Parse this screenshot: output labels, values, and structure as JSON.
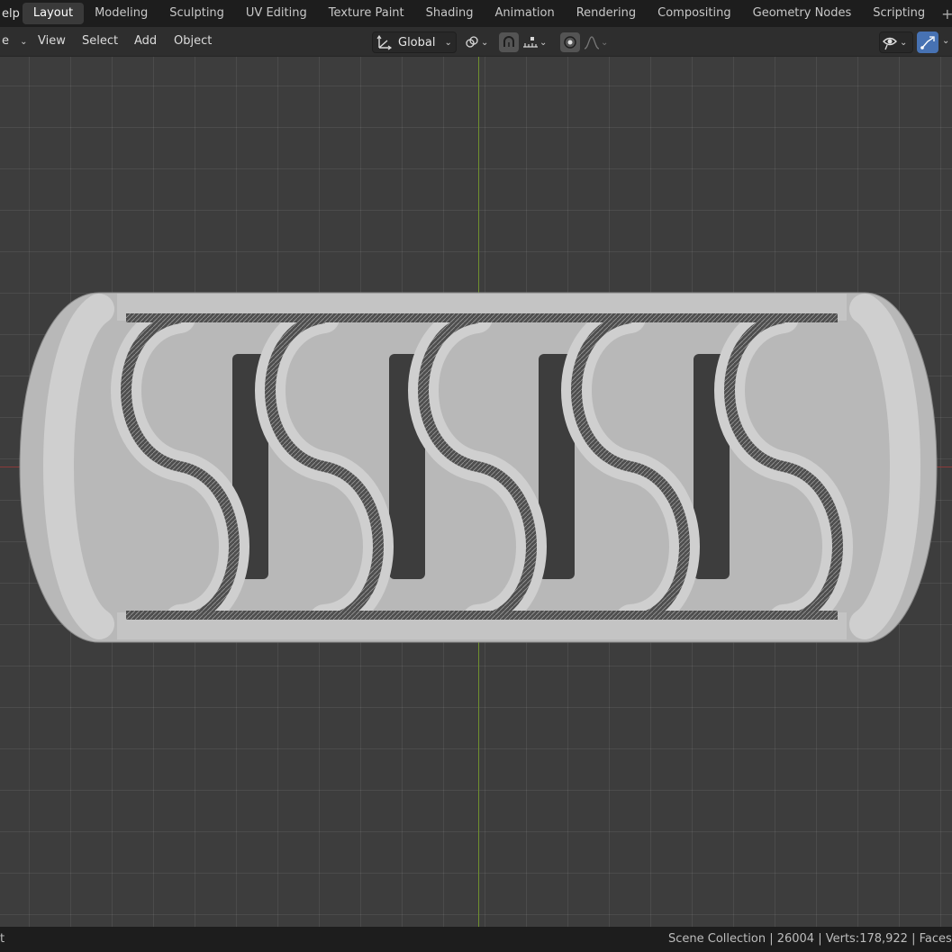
{
  "topbar": {
    "help_label": "elp",
    "tabs": [
      "Layout",
      "Modeling",
      "Sculpting",
      "UV Editing",
      "Texture Paint",
      "Shading",
      "Animation",
      "Rendering",
      "Compositing",
      "Geometry Nodes",
      "Scripting"
    ],
    "active_tab": "Layout",
    "add_workspace_icon": "plus-icon"
  },
  "viewport_header": {
    "mode_label": "e",
    "menus": [
      "View",
      "Select",
      "Add",
      "Object"
    ],
    "orientation_label": "Global",
    "icons": [
      "transform-orientation-icon",
      "pivot-icon",
      "snap-icon",
      "snap-increment-icon",
      "proportional-edit-icon",
      "falloff-icon",
      "visibility-icon",
      "gizmo-icon"
    ]
  },
  "statusbar": {
    "left_text": "t",
    "right_text": "Scene Collection | 26004 | Verts:178,922 | Faces"
  },
  "colors": {
    "accent": "#4772b3",
    "x_axis": "#8c3a3a",
    "y_axis": "#6f8f2e"
  }
}
